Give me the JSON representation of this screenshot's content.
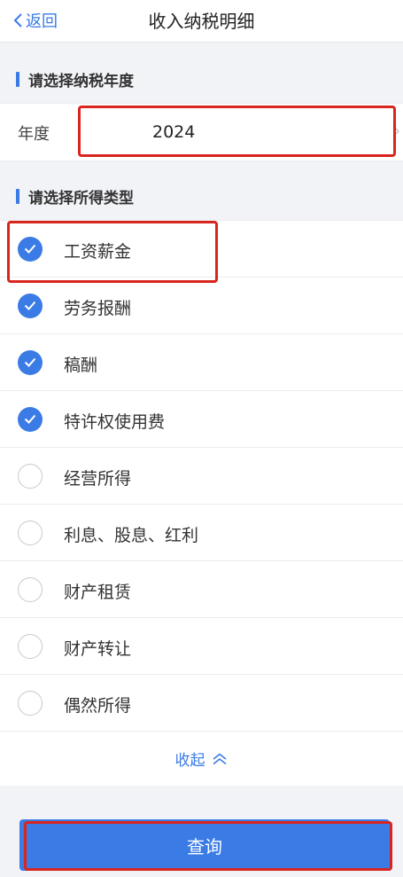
{
  "nav": {
    "back_label": "返回",
    "title": "收入纳税明细"
  },
  "year_section": {
    "title": "请选择纳税年度",
    "label": "年度",
    "value": "2024"
  },
  "type_section": {
    "title": "请选择所得类型",
    "items": [
      {
        "label": "工资薪金",
        "checked": true
      },
      {
        "label": "劳务报酬",
        "checked": true
      },
      {
        "label": "稿酬",
        "checked": true
      },
      {
        "label": "特许权使用费",
        "checked": true
      },
      {
        "label": "经营所得",
        "checked": false
      },
      {
        "label": "利息、股息、红利",
        "checked": false
      },
      {
        "label": "财产租赁",
        "checked": false
      },
      {
        "label": "财产转让",
        "checked": false
      },
      {
        "label": "偶然所得",
        "checked": false
      }
    ],
    "collapse_label": "收起"
  },
  "query_button": "查询",
  "colors": {
    "accent": "#3a7be6",
    "highlight": "#d8261f"
  }
}
